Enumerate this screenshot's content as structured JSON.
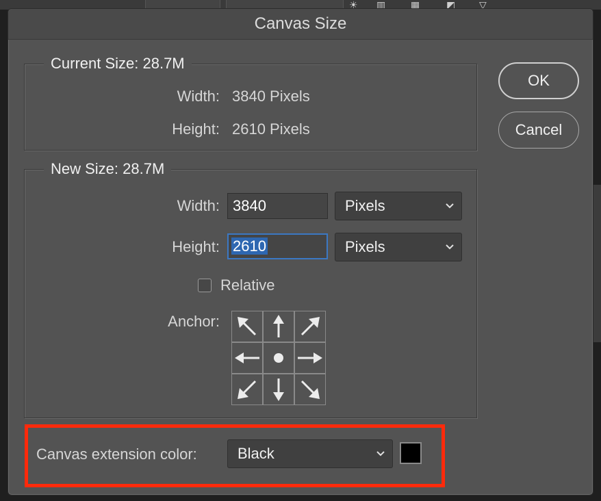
{
  "dialog": {
    "title": "Canvas Size",
    "current_size": {
      "legend": "Current Size: 28.7M",
      "width_label": "Width:",
      "width_value": "3840 Pixels",
      "height_label": "Height:",
      "height_value": "2610 Pixels"
    },
    "new_size": {
      "legend": "New Size: 28.7M",
      "width_label": "Width:",
      "width_value": "3840",
      "width_unit": "Pixels",
      "height_label": "Height:",
      "height_value": "2610",
      "height_unit": "Pixels",
      "relative_label": "Relative",
      "relative_checked": false,
      "anchor_label": "Anchor:",
      "anchor_selected": "center"
    },
    "extension": {
      "label": "Canvas extension color:",
      "value": "Black",
      "swatch_color": "#000000"
    },
    "buttons": {
      "ok": "OK",
      "cancel": "Cancel"
    },
    "highlight_color": "#ff2a0b"
  }
}
